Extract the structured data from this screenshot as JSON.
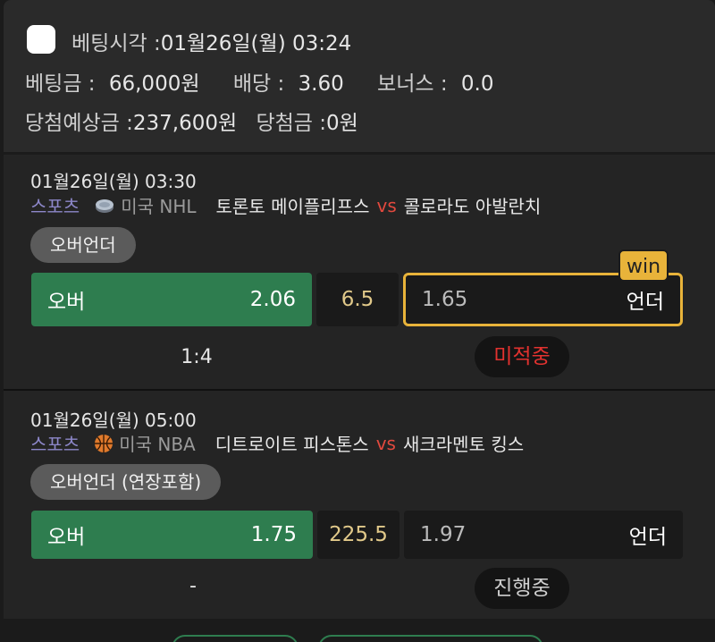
{
  "summary": {
    "bet_time_label": "베팅시각 :",
    "bet_time": "01월26일(월) 03:24",
    "stake_label": "베팅금 :",
    "stake": "66,000원",
    "odds_label": "배당 :",
    "odds": "3.60",
    "bonus_label": "보너스 :",
    "bonus": "0.0",
    "expected_label": "당첨예상금 :",
    "expected": "237,600원",
    "payout_label": "당첨금 :",
    "payout": "0원"
  },
  "games": [
    {
      "time": "01월26일(월) 03:30",
      "sport": "스포츠",
      "league": "미국 NHL",
      "home": "토론토 메이플리프스",
      "vs": "vs",
      "away": "콜로라도 아발란치",
      "market": "오버언더",
      "over_label": "오버",
      "over_odds": "2.06",
      "line": "6.5",
      "under_odds": "1.65",
      "under_label": "언더",
      "win_badge": "win",
      "score": "1:4",
      "status": "미적중"
    },
    {
      "time": "01월26일(월) 05:00",
      "sport": "스포츠",
      "league": "미국 NBA",
      "home": "디트로이트 피스톤스",
      "vs": "vs",
      "away": "새크라멘토 킹스",
      "market": "오버언더 (연장포함)",
      "over_label": "오버",
      "over_odds": "1.75",
      "line": "225.5",
      "under_odds": "1.97",
      "under_label": "언더",
      "score": "-",
      "status": "진행중"
    }
  ],
  "colors": {
    "accent_green": "#2e7d4f",
    "win_gold": "#e8b33a",
    "lose_red": "#e2322f",
    "sport_purple": "#8d87c9"
  },
  "icons": {
    "nhl": "hockey-puck-icon",
    "nba": "basketball-icon"
  }
}
